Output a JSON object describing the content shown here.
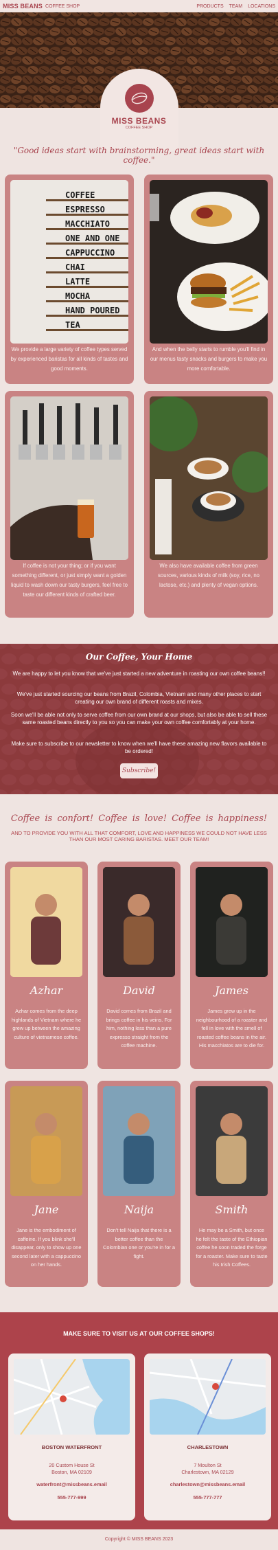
{
  "nav": {
    "brand": "MISS BEANS",
    "brand_sub": "COFFEE SHOP",
    "links": [
      "PRODUCTS",
      "TEAM",
      "LOCATIONS"
    ]
  },
  "logo": {
    "title": "MISS BEANS",
    "sub": "COFFEE SHOP"
  },
  "quote": "\"Good ideas start with brainstorming, great ideas start with coffee.\"",
  "products": [
    {
      "text": "We provide a large variety of coffee types served by experienced baristas for all kinds of tastes and good moments.",
      "board": [
        "COFFEE",
        "ESPRESSO",
        "MACCHIATO",
        "ONE AND ONE",
        "CAPPUCCINO",
        "CHAI",
        "LATTE",
        "MOCHA",
        "HAND POURED",
        "TEA"
      ]
    },
    {
      "text": "And when the belly starts to rumble you'll find in our menus tasty snacks and burgers to make you more comfortable."
    },
    {
      "text": "If coffee is not your thing; or if you want something different, or just simply want a golden liquid to wash down our tasty burgers, feel free to taste our different kinds of crafted beer."
    },
    {
      "text": "We also have available coffee from green sources, various kinds of milk (soy, rice, no lactose, etc.) and plenty of vegan options."
    }
  ],
  "our_coffee": {
    "title": "Our Coffee, Your Home",
    "p1": "We are happy to let you know that we've just started a new adventure in roasting our own coffee beans!!",
    "p2": "We've just started sourcing our beans from Brazil, Colombia, Vietnam and many other places to start creating our own brand of different roasts and mixes.",
    "p3": "Soon we'll be able not only to serve coffee from our own brand at our shops, but also be able to sell these same roasted beans directly to you so you can make your own coffee comfortably at your home.",
    "p4": "Make sure to subscribe to our newsletter to know when we'll have these amazing new flavors available to be ordered!",
    "button": "Subscribe!"
  },
  "team": {
    "mottos": "Coffee is confort!   Coffee is love!   Coffee is happiness!",
    "intro": "AND TO PROVIDE YOU WITH ALL THAT COMFORT, LOVE AND HAPPINESS WE COULD NOT HAVE LESS THAN OUR MOST CARING BARISTAS. MEET OUR TEAM!",
    "members": [
      {
        "name": "Azhar",
        "bio": "Azhar comes from the deep highlands of Vietnam where he grew up between the amazing culture of vietnamese coffee."
      },
      {
        "name": "David",
        "bio": "David comes from Brazil and brings coffee in his veins. For him, nothing less than a pure expresso straight from the coffee machine."
      },
      {
        "name": "James",
        "bio": "James grew up in the neighbourhood of a roaster and fell in love with the smell of roasted coffee beans in the air. His macchiatos are to die for."
      },
      {
        "name": "Jane",
        "bio": "Jane is the embodiment of caffeine. If you blink she'll disappear, only to show up one second later with a cappuccino on her hands."
      },
      {
        "name": "Naija",
        "bio": "Don't tell Naija that there is a better coffee than the Colombian one or you're in for a fight."
      },
      {
        "name": "Smith",
        "bio": "He may be a Smith, but once he felt the taste of the Ethiopian coffee he soon traded the forge for a roaster. Make sure to taste his Irish Coffees."
      }
    ]
  },
  "visit": {
    "title": "MAKE SURE TO VISIT US AT OUR COFFEE SHOPS!",
    "shops": [
      {
        "name": "BOSTON WATERFRONT",
        "addr1": "20 Custom House St",
        "addr2": "Boston, MA 02109",
        "email": "waterfront@missbeans.email",
        "phone": "555-777-999"
      },
      {
        "name": "CHARLESTOWN",
        "addr1": "7 Moulton St",
        "addr2": "Charlestown, MA 02129",
        "email": "charlestown@missbeans.email",
        "phone": "555-777-777"
      }
    ]
  },
  "footer": "Copyright © MISS BEANS 2023",
  "colors": {
    "accent": "#a8444e",
    "card": "#c98383",
    "band": "#8c3a3c",
    "bg": "#efe4e1"
  }
}
